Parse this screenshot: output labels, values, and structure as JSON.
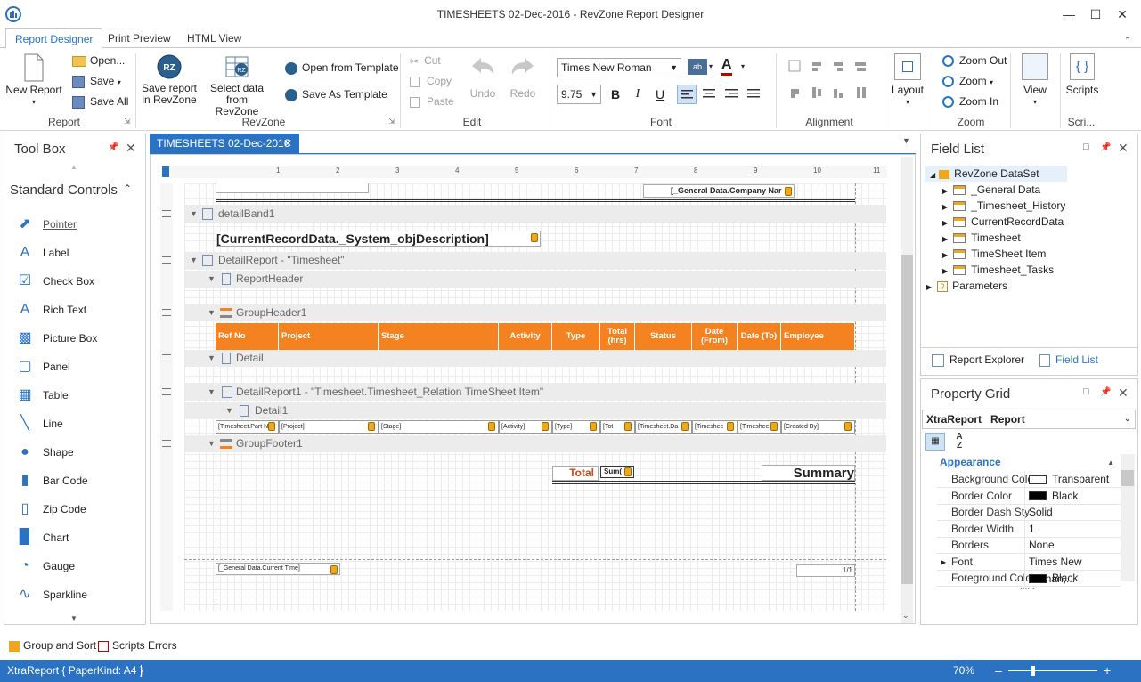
{
  "window": {
    "title": "TIMESHEETS 02-Dec-2016 - RevZone Report Designer"
  },
  "ribbon_tabs": [
    "Report Designer",
    "Print Preview",
    "HTML View"
  ],
  "ribbon": {
    "report": {
      "new_report": "New Report",
      "open": "Open...",
      "save": "Save",
      "save_all": "Save All",
      "label": "Report"
    },
    "revzone": {
      "save_report": "Save report",
      "save_report2": "in RevZone",
      "select_data": "Select data",
      "select_data2": "from RevZone",
      "open_template": "Open from Template",
      "save_template": "Save As Template",
      "label": "RevZone"
    },
    "edit": {
      "cut": "Cut",
      "copy": "Copy",
      "paste": "Paste",
      "undo": "Undo",
      "redo": "Redo",
      "label": "Edit"
    },
    "font": {
      "family": "Times New Roman",
      "size": "9.75",
      "label": "Font"
    },
    "alignment": {
      "label": "Alignment"
    },
    "layout": {
      "label": "Layout"
    },
    "zoom": {
      "zoom_out": "Zoom Out",
      "zoom": "Zoom",
      "zoom_in": "Zoom In",
      "label": "Zoom"
    },
    "view": {
      "label": "View"
    },
    "scripts": {
      "label": "Scripts",
      "group": "Scri..."
    }
  },
  "toolbox": {
    "title": "Tool Box",
    "section": "Standard Controls",
    "items": [
      "Pointer",
      "Label",
      "Check Box",
      "Rich Text",
      "Picture Box",
      "Panel",
      "Table",
      "Line",
      "Shape",
      "Bar Code",
      "Zip Code",
      "Chart",
      "Gauge",
      "Sparkline"
    ]
  },
  "document_tab": "TIMESHEETS 02-Dec-2016",
  "designer": {
    "company_field": "[_General Data.Company Nar",
    "bands": {
      "detailBand1": "detailBand1",
      "detail_report": "DetailReport - \"Timesheet\"",
      "report_header": "ReportHeader",
      "group_header": "GroupHeader1",
      "detail": "Detail",
      "detail_report1": "DetailReport1 - \"Timesheet.Timesheet_Relation TimeSheet Item\"",
      "detail1": "Detail1",
      "group_footer": "GroupFooter1"
    },
    "description_field": "[CurrentRecordData._System_objDescription]",
    "columns": [
      "Ref No",
      "Project",
      "Stage",
      "Activity",
      "Type",
      "Total (hrs)",
      "Status",
      "Date (From)",
      "Date (To)",
      "Employee"
    ],
    "detail_cells": [
      "[Timesheet.Part N",
      "[Project]",
      "[Stage]",
      "[Activity]",
      "[Type]",
      "[Tot",
      "[Timesheet.Da",
      "[Timeshee",
      "[Timeshee",
      "[Created By]"
    ],
    "total_label": "Total",
    "sum_field": "Sum(",
    "summary_label": "Summary",
    "current_time_field": "[_General Data.Current Time]",
    "page_number": "1/1"
  },
  "field_list": {
    "title": "Field List",
    "root": "RevZone DataSet",
    "items": [
      "_General Data",
      "_Timesheet_History",
      "CurrentRecordData",
      "Timesheet",
      "TimeSheet Item",
      "Timesheet_Tasks"
    ],
    "parameters": "Parameters",
    "tabs": [
      "Report Explorer",
      "Field List"
    ]
  },
  "property_grid": {
    "title": "Property Grid",
    "object": "XtraReport",
    "object_type": "Report",
    "category": "Appearance",
    "rows": [
      {
        "name": "Background Colo",
        "value": "Transparent",
        "swatch": "#ffffff"
      },
      {
        "name": "Border Color",
        "value": "Black",
        "swatch": "#000000"
      },
      {
        "name": "Border Dash Sty",
        "value": "Solid"
      },
      {
        "name": "Border Width",
        "value": "1"
      },
      {
        "name": "Borders",
        "value": "None"
      },
      {
        "name": "Font",
        "value": "Times New Roman,..."
      },
      {
        "name": "Foreground Colo",
        "value": "Black",
        "swatch": "#000000"
      }
    ]
  },
  "bottom_tabs": [
    "Group and Sort",
    "Scripts Errors"
  ],
  "status": {
    "left": "XtraReport { PaperKind: A4 }",
    "zoom": "70%"
  },
  "colors": {
    "accent": "#2b73c2",
    "header_orange": "#f58220"
  }
}
